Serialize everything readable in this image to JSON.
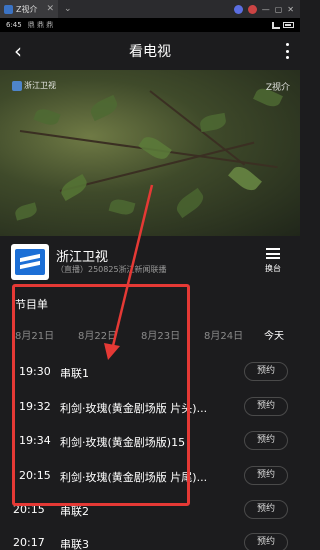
{
  "browser": {
    "tab_title": "Z视介",
    "tab_close": "✕",
    "tab_more": "⌄"
  },
  "status": {
    "time": "6:45",
    "icons": "鼎 鼎 鼎"
  },
  "header": {
    "back_icon": "back-arrow-icon",
    "title": "看电视",
    "more_icon": "more-vertical-icon"
  },
  "video": {
    "watermark_left": "浙江卫视",
    "watermark_right": "Z视介"
  },
  "channel": {
    "name": "浙江卫视",
    "live_text": "（直播）250825浙江新闻联播",
    "switch_label": "换台"
  },
  "program_guide": {
    "title": "节目单",
    "dates": [
      "8月21日",
      "8月22日",
      "8月23日",
      "8月24日",
      "今天"
    ],
    "selected_date": "今天",
    "items": [
      {
        "time": "19:30",
        "name": "串联1",
        "action": "预约"
      },
      {
        "time": "19:32",
        "name": "利剑·玫瑰(黄金剧场版 片头)...",
        "action": "预约"
      },
      {
        "time": "19:34",
        "name": "利剑·玫瑰(黄金剧场版)15",
        "action": "预约"
      },
      {
        "time": "20:15",
        "name": "利剑·玫瑰(黄金剧场版 片尾)...",
        "action": "预约"
      },
      {
        "time": "20:15",
        "name": "串联2",
        "action": "预约"
      },
      {
        "time": "20:17",
        "name": "串联3",
        "action": "预约"
      }
    ]
  },
  "annotation_color": "#e53935"
}
